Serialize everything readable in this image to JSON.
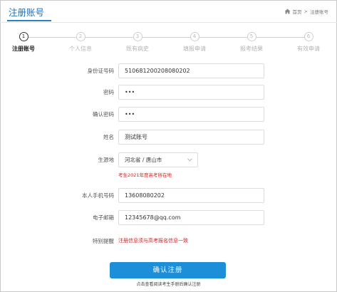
{
  "header": {
    "title": "注册账号",
    "breadcrumb": {
      "home": "首页",
      "separator": ">",
      "current": "注册账号"
    }
  },
  "steps": [
    {
      "number": "1",
      "label": "注册账号",
      "active": true
    },
    {
      "number": "2",
      "label": "个人信息",
      "active": false
    },
    {
      "number": "3",
      "label": "既有病史",
      "active": false
    },
    {
      "number": "4",
      "label": "填报申请",
      "active": false
    },
    {
      "number": "5",
      "label": "报考结果",
      "active": false
    },
    {
      "number": "6",
      "label": "有效申请",
      "active": false
    }
  ],
  "form": {
    "id_number": {
      "label": "身份证号码",
      "value": "510681200208080202"
    },
    "password": {
      "label": "密码",
      "value": "•••"
    },
    "confirm_password": {
      "label": "确认密码",
      "value": "•••"
    },
    "name": {
      "label": "姓名",
      "value": "测试账号"
    },
    "origin": {
      "label": "生源地",
      "value": "河北省 / 唐山市",
      "hint": "考生2021年度高考所在地"
    },
    "phone": {
      "label": "本人手机号码",
      "value": "13608080202"
    },
    "email": {
      "label": "电子邮箱",
      "value": "12345678@qq.com"
    },
    "notice": {
      "label": "特别提醒",
      "text": "注册信息须与高考报名信息一致"
    }
  },
  "submit_label": "确认注册",
  "footnote": "点击查看阅读考生手册后确认注册",
  "colors": {
    "accent": "#1d8fd8",
    "warning": "#d42020",
    "title": "#1a6fb8"
  }
}
